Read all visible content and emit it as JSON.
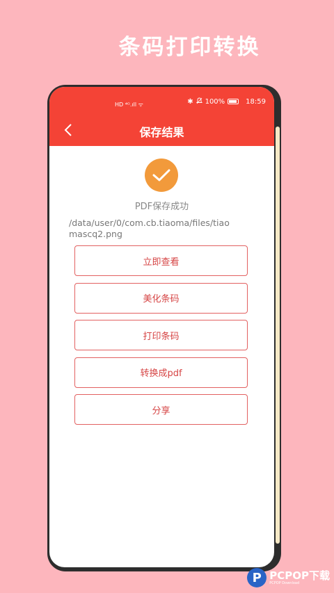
{
  "promo": {
    "title": "条码打印转换"
  },
  "status_bar": {
    "left_icons": "HD ⁴ᴳ.ıll ᯤ",
    "bluetooth": "✱",
    "mute": "🔕",
    "battery_percent": "100%",
    "time": "18:59"
  },
  "navbar": {
    "title": "保存结果",
    "back_icon": "chevron-left-icon"
  },
  "result": {
    "message": "PDF保存成功",
    "file_path": "/data/user/0/com.cb.tiaoma/files/tiaomascq2.png"
  },
  "actions": [
    {
      "label": "立即查看"
    },
    {
      "label": "美化条码"
    },
    {
      "label": "打印条码"
    },
    {
      "label": "转换成pdf"
    },
    {
      "label": "分享"
    }
  ],
  "watermark": {
    "brand": "PCPOP下载",
    "sub": "PCPOP Download"
  },
  "colors": {
    "accent": "#f44336",
    "background": "#fdb6bd",
    "success": "#f29a3b"
  }
}
